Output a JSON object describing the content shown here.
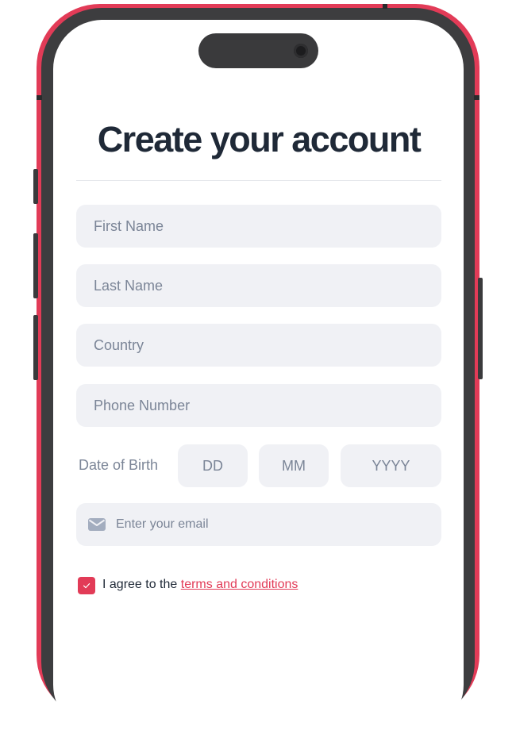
{
  "colors": {
    "accent": "#e23b57",
    "frame": "#3d3d3f",
    "field_bg": "#f0f1f5",
    "placeholder": "#7b8597",
    "title": "#1f2937"
  },
  "form": {
    "title": "Create your account",
    "first_name_placeholder": "First Name",
    "last_name_placeholder": "Last Name",
    "country_placeholder": "Country",
    "phone_placeholder": "Phone Number",
    "dob_label": "Date of Birth",
    "dob_day_placeholder": "DD",
    "dob_month_placeholder": "MM",
    "dob_year_placeholder": "YYYY",
    "email_placeholder": "Enter your email",
    "email_icon": "envelope-icon",
    "agree_checked": true,
    "agree_text": "I agree to the",
    "terms_link": "terms and conditions"
  }
}
